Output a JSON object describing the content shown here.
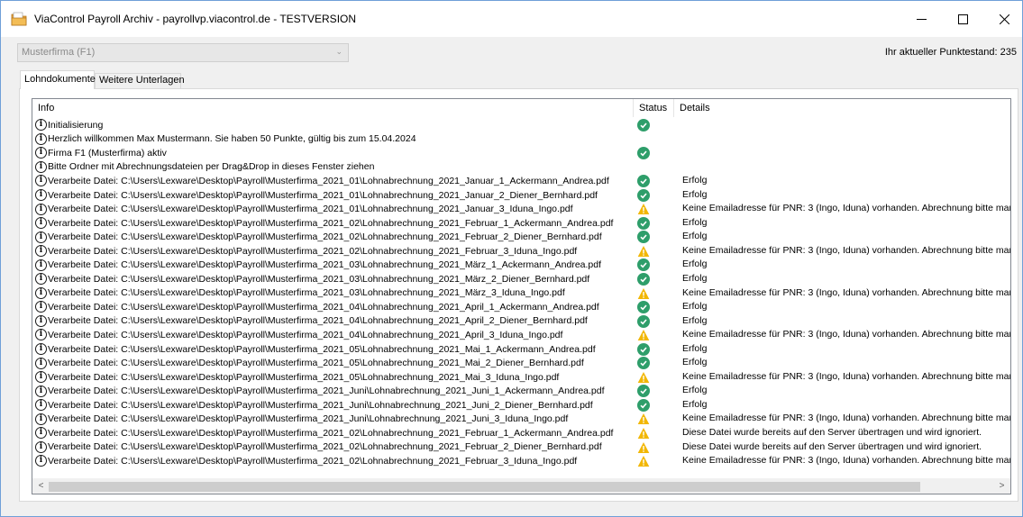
{
  "window": {
    "title": "ViaControl Payroll Archiv - payrollvp.viacontrol.de - TESTVERSION",
    "minimize_symbol": "—",
    "maximize_symbol": "☐",
    "close_symbol": "✕"
  },
  "toolbar": {
    "company_value": "Musterfirma (F1)",
    "points_text": "Ihr aktueller Punktestand: 235"
  },
  "tabs": [
    {
      "label": "Lohndokumente",
      "active": true
    },
    {
      "label": "Weitere Unterlagen",
      "active": false
    }
  ],
  "table": {
    "headers": {
      "info": "Info",
      "status": "Status",
      "details": "Details"
    },
    "rows": [
      {
        "info": "Initialisierung",
        "status": "ok",
        "details": ""
      },
      {
        "info": "Herzlich willkommen Max Mustermann. Sie haben 50 Punkte, gültig bis zum 15.04.2024",
        "status": "",
        "details": ""
      },
      {
        "info": "Firma F1 (Musterfirma) aktiv",
        "status": "ok",
        "details": ""
      },
      {
        "info": "Bitte Ordner mit Abrechnungsdateien per Drag&Drop in dieses Fenster ziehen",
        "status": "",
        "details": ""
      },
      {
        "info": "Verarbeite Datei: C:\\Users\\Lexware\\Desktop\\Payroll\\Musterfirma_2021_01\\Lohnabrechnung_2021_Januar_1_Ackermann_Andrea.pdf",
        "status": "ok",
        "details": "Erfolg"
      },
      {
        "info": "Verarbeite Datei: C:\\Users\\Lexware\\Desktop\\Payroll\\Musterfirma_2021_01\\Lohnabrechnung_2021_Januar_2_Diener_Bernhard.pdf",
        "status": "ok",
        "details": "Erfolg"
      },
      {
        "info": "Verarbeite Datei: C:\\Users\\Lexware\\Desktop\\Payroll\\Musterfirma_2021_01\\Lohnabrechnung_2021_Januar_3_Iduna_Ingo.pdf",
        "status": "warn",
        "details": "Keine Emailadresse für PNR: 3 (Ingo, Iduna) vorhanden. Abrechnung bitte manue"
      },
      {
        "info": "Verarbeite Datei: C:\\Users\\Lexware\\Desktop\\Payroll\\Musterfirma_2021_02\\Lohnabrechnung_2021_Februar_1_Ackermann_Andrea.pdf",
        "status": "ok",
        "details": "Erfolg"
      },
      {
        "info": "Verarbeite Datei: C:\\Users\\Lexware\\Desktop\\Payroll\\Musterfirma_2021_02\\Lohnabrechnung_2021_Februar_2_Diener_Bernhard.pdf",
        "status": "ok",
        "details": "Erfolg"
      },
      {
        "info": "Verarbeite Datei: C:\\Users\\Lexware\\Desktop\\Payroll\\Musterfirma_2021_02\\Lohnabrechnung_2021_Februar_3_Iduna_Ingo.pdf",
        "status": "warn",
        "details": "Keine Emailadresse für PNR: 3 (Ingo, Iduna) vorhanden. Abrechnung bitte manue"
      },
      {
        "info": "Verarbeite Datei: C:\\Users\\Lexware\\Desktop\\Payroll\\Musterfirma_2021_03\\Lohnabrechnung_2021_März_1_Ackermann_Andrea.pdf",
        "status": "ok",
        "details": "Erfolg"
      },
      {
        "info": "Verarbeite Datei: C:\\Users\\Lexware\\Desktop\\Payroll\\Musterfirma_2021_03\\Lohnabrechnung_2021_März_2_Diener_Bernhard.pdf",
        "status": "ok",
        "details": "Erfolg"
      },
      {
        "info": "Verarbeite Datei: C:\\Users\\Lexware\\Desktop\\Payroll\\Musterfirma_2021_03\\Lohnabrechnung_2021_März_3_Iduna_Ingo.pdf",
        "status": "warn",
        "details": "Keine Emailadresse für PNR: 3 (Ingo, Iduna) vorhanden. Abrechnung bitte manue"
      },
      {
        "info": "Verarbeite Datei: C:\\Users\\Lexware\\Desktop\\Payroll\\Musterfirma_2021_04\\Lohnabrechnung_2021_April_1_Ackermann_Andrea.pdf",
        "status": "ok",
        "details": "Erfolg"
      },
      {
        "info": "Verarbeite Datei: C:\\Users\\Lexware\\Desktop\\Payroll\\Musterfirma_2021_04\\Lohnabrechnung_2021_April_2_Diener_Bernhard.pdf",
        "status": "ok",
        "details": "Erfolg"
      },
      {
        "info": "Verarbeite Datei: C:\\Users\\Lexware\\Desktop\\Payroll\\Musterfirma_2021_04\\Lohnabrechnung_2021_April_3_Iduna_Ingo.pdf",
        "status": "warn",
        "details": "Keine Emailadresse für PNR: 3 (Ingo, Iduna) vorhanden. Abrechnung bitte manue"
      },
      {
        "info": "Verarbeite Datei: C:\\Users\\Lexware\\Desktop\\Payroll\\Musterfirma_2021_05\\Lohnabrechnung_2021_Mai_1_Ackermann_Andrea.pdf",
        "status": "ok",
        "details": "Erfolg"
      },
      {
        "info": "Verarbeite Datei: C:\\Users\\Lexware\\Desktop\\Payroll\\Musterfirma_2021_05\\Lohnabrechnung_2021_Mai_2_Diener_Bernhard.pdf",
        "status": "ok",
        "details": "Erfolg"
      },
      {
        "info": "Verarbeite Datei: C:\\Users\\Lexware\\Desktop\\Payroll\\Musterfirma_2021_05\\Lohnabrechnung_2021_Mai_3_Iduna_Ingo.pdf",
        "status": "warn",
        "details": "Keine Emailadresse für PNR: 3 (Ingo, Iduna) vorhanden. Abrechnung bitte manue"
      },
      {
        "info": "Verarbeite Datei: C:\\Users\\Lexware\\Desktop\\Payroll\\Musterfirma_2021_Juni\\Lohnabrechnung_2021_Juni_1_Ackermann_Andrea.pdf",
        "status": "ok",
        "details": "Erfolg"
      },
      {
        "info": "Verarbeite Datei: C:\\Users\\Lexware\\Desktop\\Payroll\\Musterfirma_2021_Juni\\Lohnabrechnung_2021_Juni_2_Diener_Bernhard.pdf",
        "status": "ok",
        "details": "Erfolg"
      },
      {
        "info": "Verarbeite Datei: C:\\Users\\Lexware\\Desktop\\Payroll\\Musterfirma_2021_Juni\\Lohnabrechnung_2021_Juni_3_Iduna_Ingo.pdf",
        "status": "warn",
        "details": "Keine Emailadresse für PNR: 3 (Ingo, Iduna) vorhanden. Abrechnung bitte manue"
      },
      {
        "info": "Verarbeite Datei: C:\\Users\\Lexware\\Desktop\\Payroll\\Musterfirma_2021_02\\Lohnabrechnung_2021_Februar_1_Ackermann_Andrea.pdf",
        "status": "warn",
        "details": "Diese Datei wurde bereits auf den Server übertragen und wird ignoriert."
      },
      {
        "info": "Verarbeite Datei: C:\\Users\\Lexware\\Desktop\\Payroll\\Musterfirma_2021_02\\Lohnabrechnung_2021_Februar_2_Diener_Bernhard.pdf",
        "status": "warn",
        "details": "Diese Datei wurde bereits auf den Server übertragen und wird ignoriert."
      },
      {
        "info": "Verarbeite Datei: C:\\Users\\Lexware\\Desktop\\Payroll\\Musterfirma_2021_02\\Lohnabrechnung_2021_Februar_3_Iduna_Ingo.pdf",
        "status": "warn",
        "details": "Keine Emailadresse für PNR: 3 (Ingo, Iduna) vorhanden. Abrechnung bitte manue"
      }
    ]
  },
  "scrollbar": {
    "left_symbol": "<",
    "right_symbol": ">"
  },
  "colors": {
    "ok": "#2e9e6a",
    "warn": "#f2b705",
    "window_border": "#6f9fd8"
  }
}
